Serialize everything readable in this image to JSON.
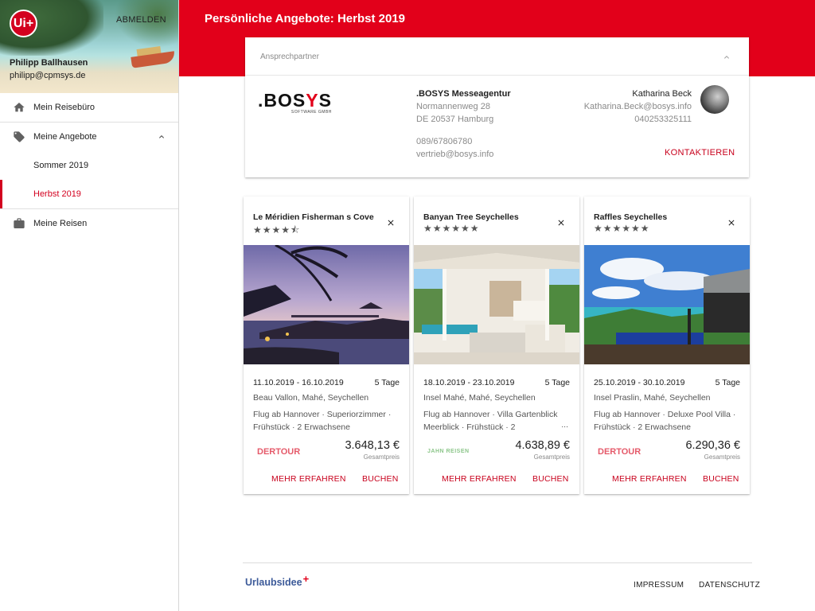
{
  "sidebar": {
    "logo_text": "Ui+",
    "logout_label": "ABMELDEN",
    "user_name": "Philipp Ballhausen",
    "user_email": "philipp@cpmsys.de",
    "nav": [
      {
        "label": "Mein Reisebüro",
        "icon": "home-icon"
      },
      {
        "label": "Meine Angebote",
        "icon": "tag-icon",
        "expanded": true
      },
      {
        "label": "Sommer 2019",
        "icon": ""
      },
      {
        "label": "Herbst 2019",
        "icon": "",
        "active": true
      },
      {
        "label": "Meine Reisen",
        "icon": "briefcase-icon"
      }
    ]
  },
  "header": {
    "title": "Persönliche Angebote: Herbst 2019",
    "accent": "#e2001a"
  },
  "contact": {
    "heading": "Ansprechpartner",
    "logo_word": ".BOSYS",
    "logo_sub": "SOFTWARE GMBH",
    "agency": {
      "name": ".BOSYS Messeagentur",
      "street": "Normannenweg 28",
      "city": "DE 20537 Hamburg",
      "phone": "089/67806780",
      "email": "vertrieb@bosys.info"
    },
    "person": {
      "name": "Katharina Beck",
      "email": "Katharina.Beck@bosys.info",
      "phone": "040253325111"
    },
    "button": "KONTAKTIEREN"
  },
  "offers": [
    {
      "title": "Le Méridien Fisherman s Cove",
      "stars": "★★★★⯪",
      "dates": "11.10.2019 - 16.10.2019",
      "days": "5 Tage",
      "location": "Beau Vallon, Mahé, Seychellen",
      "desc": "Flug ab Hannover · Superiorzimmer · Frühstück · 2 Erwachsene",
      "operator": "DERTOUR",
      "price": "3.648,13 €",
      "price_label": "Gesamtpreis",
      "more": "MEHR ERFAHREN",
      "book": "BUCHEN"
    },
    {
      "title": "Banyan Tree Seychelles",
      "stars": "★★★★★★",
      "dates": "18.10.2019 - 23.10.2019",
      "days": "5 Tage",
      "location": "Insel Mahé, Mahé, Seychellen",
      "desc": "Flug ab Hannover · Villa Gartenblick Meerblick · Frühstück · 2",
      "ellipsis": "...",
      "operator": "JAHN REISEN",
      "price": "4.638,89 €",
      "price_label": "Gesamtpreis",
      "more": "MEHR ERFAHREN",
      "book": "BUCHEN"
    },
    {
      "title": "Raffles Seychelles",
      "stars": "★★★★★★",
      "dates": "25.10.2019 - 30.10.2019",
      "days": "5 Tage",
      "location": "Insel Praslin, Mahé, Seychellen",
      "desc": "Flug ab Hannover · Deluxe Pool Villa · Frühstück · 2 Erwachsene",
      "operator": "DERTOUR",
      "price": "6.290,36 €",
      "price_label": "Gesamtpreis",
      "more": "MEHR ERFAHREN",
      "book": "BUCHEN"
    }
  ],
  "footer": {
    "brand": "Urlaubsidee",
    "brand_plus": "+",
    "links": [
      "IMPRESSUM",
      "DATENSCHUTZ"
    ]
  }
}
